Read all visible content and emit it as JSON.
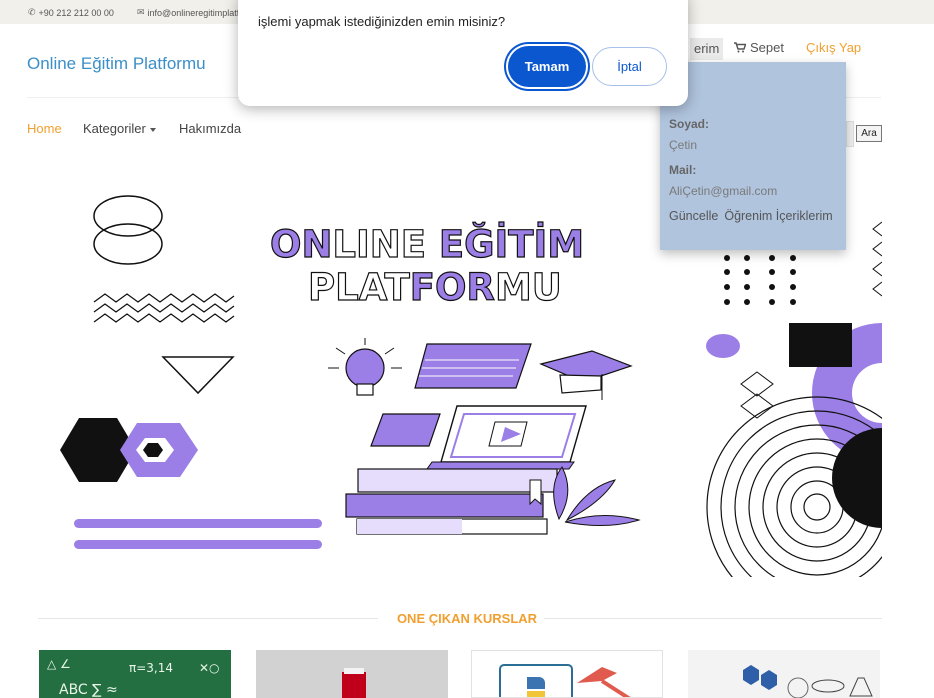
{
  "topbar": {
    "phone": "+90 212 212 00 00",
    "email": "info@onlineregitimplatfo"
  },
  "header": {
    "brand": "Online Eğitim Platformu",
    "profile_label": "erim",
    "cart_label": "Sepet",
    "logout_label": "Çıkış Yap"
  },
  "nav": {
    "home": "Home",
    "categories": "Kategoriler",
    "about": "Hakımızda",
    "search_button": "Ara"
  },
  "hero": {
    "line1_a": "ON",
    "line1_b": "LINE ",
    "line1_c": "EĞİTİM",
    "line2_a": "PLAT",
    "line2_b": "FOR",
    "line2_c": "MU"
  },
  "section": {
    "title": "ONE ÇIKAN KURSLAR"
  },
  "profile_dropdown": {
    "surname_label": "Soyad:",
    "surname_value": "Çetin",
    "mail_label": "Mail:",
    "mail_value": "AliÇetin@gmail.com",
    "update_link": "Güncelle",
    "courses_link": "Öğrenim İçeriklerim"
  },
  "dialog": {
    "message": "işlemi yapmak istediğinizden emin misiniz?",
    "ok_label": "Tamam",
    "cancel_label": "İptal"
  },
  "colors": {
    "accent": "#f0a030",
    "brand": "#3a8fc8",
    "purple": "#9b7fe6",
    "dropdown_bg": "#b0c4de",
    "dialog_button": "#0b57d0"
  },
  "icons": {
    "phone": "phone-icon",
    "mail": "envelope-icon",
    "cart": "cart-icon"
  }
}
